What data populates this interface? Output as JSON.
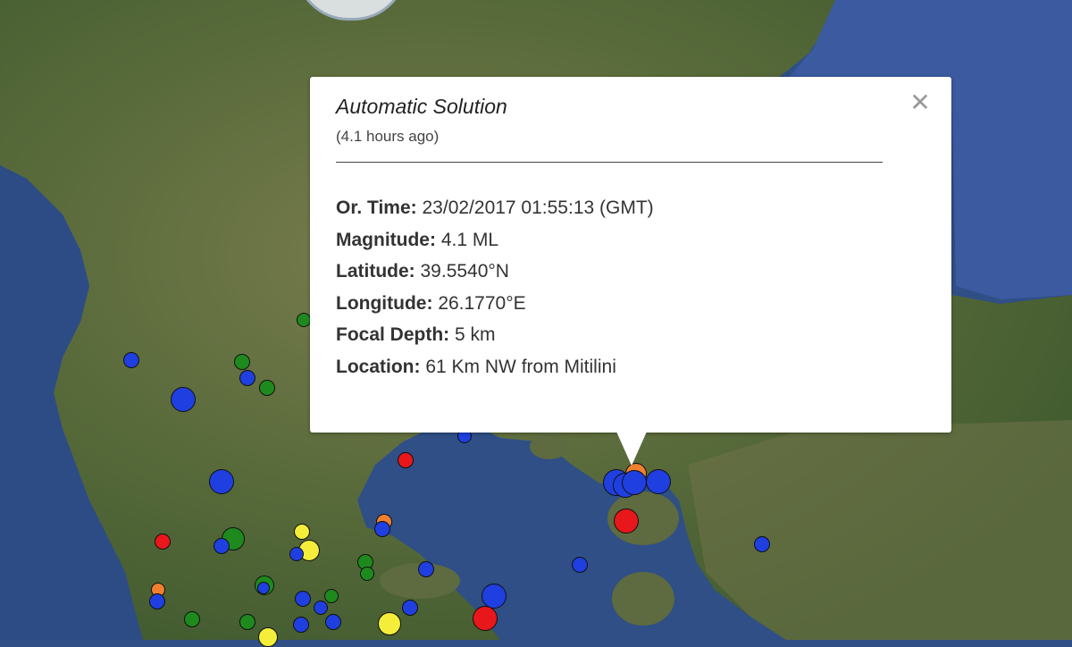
{
  "popup": {
    "title": "Automatic Solution",
    "subtitle": "(4.1 hours ago)",
    "close_glyph": "✕",
    "rows": [
      {
        "label": "Or. Time:",
        "value": "23/02/2017  01:55:13 (GMT)"
      },
      {
        "label": "Magnitude:",
        "value": "4.1 ML"
      },
      {
        "label": "Latitude:",
        "value": "39.5540°N"
      },
      {
        "label": "Longitude:",
        "value": "26.1770°E"
      },
      {
        "label": "Focal Depth:",
        "value": "5 km"
      },
      {
        "label": "Location:",
        "value": "61 Km NW from Mitilini"
      }
    ]
  },
  "colors": {
    "sea": "#2f4f86",
    "land": "#5f6b3f",
    "marker_blue": "#1f3fe0",
    "marker_green": "#1e8a1e",
    "marker_red": "#e8171b",
    "marker_yellow": "#f4ee3a",
    "marker_orange": "#f08030"
  }
}
